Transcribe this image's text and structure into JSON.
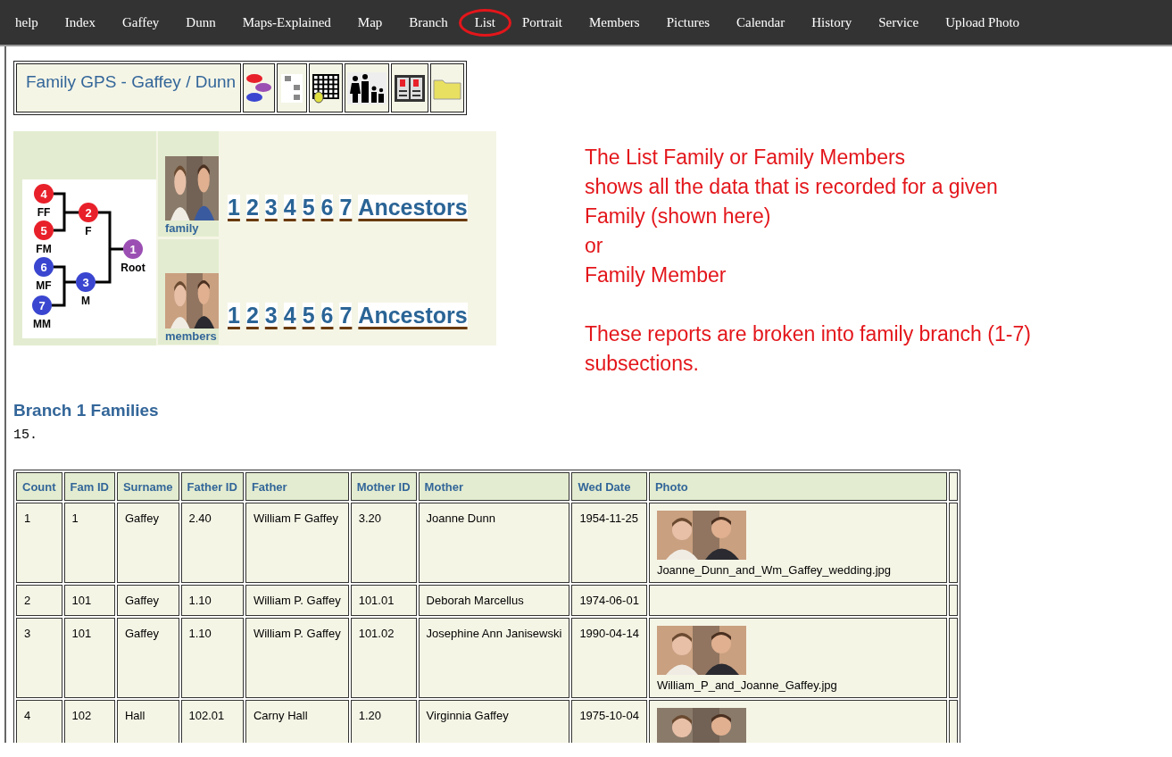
{
  "nav": [
    {
      "label": "help",
      "circled": false
    },
    {
      "label": "Index",
      "circled": false
    },
    {
      "label": "Gaffey",
      "circled": false
    },
    {
      "label": "Dunn",
      "circled": false
    },
    {
      "label": "Maps-Explained",
      "circled": false
    },
    {
      "label": "Map",
      "circled": false
    },
    {
      "label": "Branch",
      "circled": false
    },
    {
      "label": "List",
      "circled": true
    },
    {
      "label": "Portrait",
      "circled": false
    },
    {
      "label": "Members",
      "circled": false
    },
    {
      "label": "Pictures",
      "circled": false
    },
    {
      "label": "Calendar",
      "circled": false
    },
    {
      "label": "History",
      "circled": false
    },
    {
      "label": "Service",
      "circled": false
    },
    {
      "label": "Upload Photo",
      "circled": false
    }
  ],
  "toolbar": {
    "title": "Family GPS - Gaffey / Dunn"
  },
  "tree": {
    "nodes": [
      {
        "number": "4",
        "label": "FF",
        "color": "#e8202a"
      },
      {
        "number": "5",
        "label": "FM",
        "color": "#e8202a"
      },
      {
        "number": "2",
        "label": "F",
        "color": "#e8202a"
      },
      {
        "number": "6",
        "label": "MF",
        "color": "#3a46d0"
      },
      {
        "number": "7",
        "label": "MM",
        "color": "#3a46d0"
      },
      {
        "number": "3",
        "label": "M",
        "color": "#3a46d0"
      },
      {
        "number": "1",
        "label": "Root",
        "color": "#9b4fb3"
      }
    ],
    "rows": [
      {
        "caption": "family",
        "links": [
          "1",
          "2",
          "3",
          "4",
          "5",
          "6",
          "7",
          "Ancestors"
        ]
      },
      {
        "caption": "members",
        "links": [
          "1",
          "2",
          "3",
          "4",
          "5",
          "6",
          "7",
          "Ancestors"
        ]
      }
    ]
  },
  "annotation": [
    [
      "The List Family or Family Members",
      "shows all the data that is recorded for a given",
      "Family (shown here)",
      "or",
      "Family Member"
    ],
    [
      "These reports are broken into family branch (1-7)",
      "subsections."
    ]
  ],
  "section": {
    "title": "Branch 1 Families",
    "count": "15."
  },
  "table": {
    "columns": [
      "Count",
      "Fam ID",
      "Surname",
      "Father ID",
      "Father",
      "Mother ID",
      "Mother",
      "Wed Date",
      "Photo"
    ],
    "rows": [
      {
        "cells": [
          "1",
          "1",
          "Gaffey",
          "2.40",
          "William F Gaffey",
          "3.20",
          "Joanne Dunn",
          "1954-11-25"
        ],
        "photo": {
          "kind": "picture",
          "caption": "Joanne_Dunn_and_Wm_Gaffey_wedding.jpg"
        }
      },
      {
        "cells": [
          "2",
          "101",
          "Gaffey",
          "1.10",
          "William P. Gaffey",
          "101.01",
          "Deborah Marcellus",
          "1974-06-01"
        ]
      },
      {
        "cells": [
          "3",
          "101",
          "Gaffey",
          "1.10",
          "William P. Gaffey",
          "101.02",
          "Josephine Ann Janisewski",
          "1990-04-14"
        ],
        "photo": {
          "kind": "picture",
          "caption": "William_P_and_Joanne_Gaffey.jpg"
        }
      },
      {
        "cells": [
          "4",
          "102",
          "Hall",
          "102.01",
          "Carny Hall",
          "1.20",
          "Virginnia Gaffey",
          "1975-10-04"
        ],
        "photo": {
          "kind": "picture"
        }
      }
    ]
  }
}
